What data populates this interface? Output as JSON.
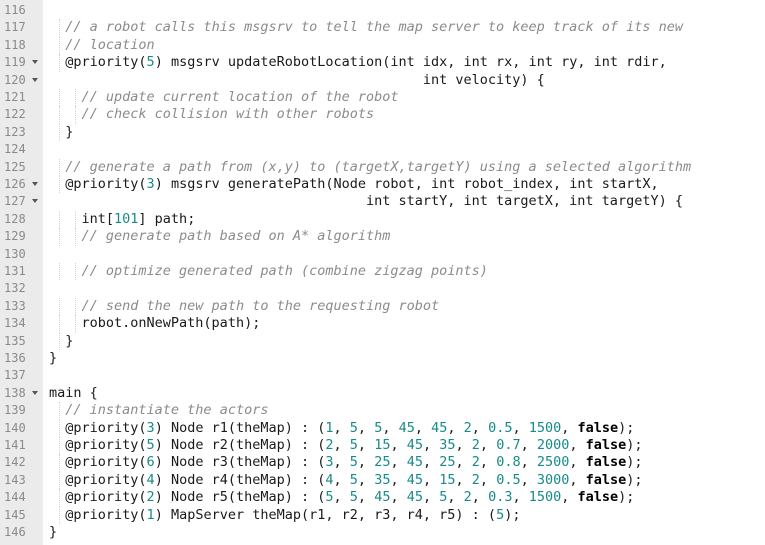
{
  "editor": {
    "lines": [
      {
        "num": "116",
        "fold": false,
        "indent": 0,
        "tokens": []
      },
      {
        "num": "117",
        "fold": false,
        "indent": 2,
        "tokens": [
          {
            "t": "comment",
            "v": "// a robot calls this msgsrv to tell the map server to keep track of its new"
          }
        ]
      },
      {
        "num": "118",
        "fold": false,
        "indent": 2,
        "tokens": [
          {
            "t": "comment",
            "v": "// location"
          }
        ]
      },
      {
        "num": "119",
        "fold": true,
        "indent": 2,
        "tokens": [
          {
            "t": "plain",
            "v": "@priority("
          },
          {
            "t": "number",
            "v": "5"
          },
          {
            "t": "plain",
            "v": ") msgsrv updateRobotLocation(int idx, int rx, int ry, int rdir,"
          }
        ]
      },
      {
        "num": "120",
        "fold": true,
        "indent": 0,
        "tokens": [
          {
            "t": "plain",
            "v": "                                              int velocity) {"
          }
        ]
      },
      {
        "num": "121",
        "fold": false,
        "indent": 4,
        "tokens": [
          {
            "t": "comment",
            "v": "// update current location of the robot"
          }
        ]
      },
      {
        "num": "122",
        "fold": false,
        "indent": 4,
        "tokens": [
          {
            "t": "comment",
            "v": "// check collision with other robots"
          }
        ]
      },
      {
        "num": "123",
        "fold": false,
        "indent": 2,
        "tokens": [
          {
            "t": "plain",
            "v": "}"
          }
        ]
      },
      {
        "num": "124",
        "fold": false,
        "indent": 0,
        "tokens": []
      },
      {
        "num": "125",
        "fold": false,
        "indent": 2,
        "tokens": [
          {
            "t": "comment",
            "v": "// generate a path from (x,y) to (targetX,targetY) using a selected algorithm"
          }
        ]
      },
      {
        "num": "126",
        "fold": true,
        "indent": 2,
        "tokens": [
          {
            "t": "plain",
            "v": "@priority("
          },
          {
            "t": "number",
            "v": "3"
          },
          {
            "t": "plain",
            "v": ") msgsrv generatePath(Node robot, int robot_index, int startX,"
          }
        ]
      },
      {
        "num": "127",
        "fold": true,
        "indent": 0,
        "tokens": [
          {
            "t": "plain",
            "v": "                                       int startY, int targetX, int targetY) {"
          }
        ]
      },
      {
        "num": "128",
        "fold": false,
        "indent": 4,
        "tokens": [
          {
            "t": "plain",
            "v": "int["
          },
          {
            "t": "number",
            "v": "101"
          },
          {
            "t": "plain",
            "v": "] path;"
          }
        ]
      },
      {
        "num": "129",
        "fold": false,
        "indent": 4,
        "tokens": [
          {
            "t": "comment",
            "v": "// generate path based on A* algorithm"
          }
        ]
      },
      {
        "num": "130",
        "fold": false,
        "indent": 0,
        "tokens": []
      },
      {
        "num": "131",
        "fold": false,
        "indent": 4,
        "tokens": [
          {
            "t": "comment",
            "v": "// optimize generated path (combine zigzag points)"
          }
        ]
      },
      {
        "num": "132",
        "fold": false,
        "indent": 0,
        "tokens": []
      },
      {
        "num": "133",
        "fold": false,
        "indent": 4,
        "tokens": [
          {
            "t": "comment",
            "v": "// send the new path to the requesting robot"
          }
        ]
      },
      {
        "num": "134",
        "fold": false,
        "indent": 4,
        "tokens": [
          {
            "t": "plain",
            "v": "robot.onNewPath(path);"
          }
        ]
      },
      {
        "num": "135",
        "fold": false,
        "indent": 2,
        "tokens": [
          {
            "t": "plain",
            "v": "}"
          }
        ]
      },
      {
        "num": "136",
        "fold": false,
        "indent": 0,
        "tokens": [
          {
            "t": "plain",
            "v": "}"
          }
        ]
      },
      {
        "num": "137",
        "fold": false,
        "indent": 0,
        "tokens": []
      },
      {
        "num": "138",
        "fold": true,
        "indent": 0,
        "tokens": [
          {
            "t": "plain",
            "v": "main {"
          }
        ]
      },
      {
        "num": "139",
        "fold": false,
        "indent": 2,
        "tokens": [
          {
            "t": "comment",
            "v": "// instantiate the actors"
          }
        ]
      },
      {
        "num": "140",
        "fold": false,
        "indent": 2,
        "tokens": [
          {
            "t": "plain",
            "v": "@priority("
          },
          {
            "t": "number",
            "v": "3"
          },
          {
            "t": "plain",
            "v": ") Node r1(theMap) : ("
          },
          {
            "t": "number",
            "v": "1"
          },
          {
            "t": "plain",
            "v": ", "
          },
          {
            "t": "number",
            "v": "5"
          },
          {
            "t": "plain",
            "v": ", "
          },
          {
            "t": "number",
            "v": "5"
          },
          {
            "t": "plain",
            "v": ", "
          },
          {
            "t": "number",
            "v": "45"
          },
          {
            "t": "plain",
            "v": ", "
          },
          {
            "t": "number",
            "v": "45"
          },
          {
            "t": "plain",
            "v": ", "
          },
          {
            "t": "number",
            "v": "2"
          },
          {
            "t": "plain",
            "v": ", "
          },
          {
            "t": "number",
            "v": "0.5"
          },
          {
            "t": "plain",
            "v": ", "
          },
          {
            "t": "number",
            "v": "1500"
          },
          {
            "t": "plain",
            "v": ", "
          },
          {
            "t": "keyword",
            "v": "false"
          },
          {
            "t": "plain",
            "v": ");"
          }
        ]
      },
      {
        "num": "141",
        "fold": false,
        "indent": 2,
        "tokens": [
          {
            "t": "plain",
            "v": "@priority("
          },
          {
            "t": "number",
            "v": "5"
          },
          {
            "t": "plain",
            "v": ") Node r2(theMap) : ("
          },
          {
            "t": "number",
            "v": "2"
          },
          {
            "t": "plain",
            "v": ", "
          },
          {
            "t": "number",
            "v": "5"
          },
          {
            "t": "plain",
            "v": ", "
          },
          {
            "t": "number",
            "v": "15"
          },
          {
            "t": "plain",
            "v": ", "
          },
          {
            "t": "number",
            "v": "45"
          },
          {
            "t": "plain",
            "v": ", "
          },
          {
            "t": "number",
            "v": "35"
          },
          {
            "t": "plain",
            "v": ", "
          },
          {
            "t": "number",
            "v": "2"
          },
          {
            "t": "plain",
            "v": ", "
          },
          {
            "t": "number",
            "v": "0.7"
          },
          {
            "t": "plain",
            "v": ", "
          },
          {
            "t": "number",
            "v": "2000"
          },
          {
            "t": "plain",
            "v": ", "
          },
          {
            "t": "keyword",
            "v": "false"
          },
          {
            "t": "plain",
            "v": ");"
          }
        ]
      },
      {
        "num": "142",
        "fold": false,
        "indent": 2,
        "tokens": [
          {
            "t": "plain",
            "v": "@priority("
          },
          {
            "t": "number",
            "v": "6"
          },
          {
            "t": "plain",
            "v": ") Node r3(theMap) : ("
          },
          {
            "t": "number",
            "v": "3"
          },
          {
            "t": "plain",
            "v": ", "
          },
          {
            "t": "number",
            "v": "5"
          },
          {
            "t": "plain",
            "v": ", "
          },
          {
            "t": "number",
            "v": "25"
          },
          {
            "t": "plain",
            "v": ", "
          },
          {
            "t": "number",
            "v": "45"
          },
          {
            "t": "plain",
            "v": ", "
          },
          {
            "t": "number",
            "v": "25"
          },
          {
            "t": "plain",
            "v": ", "
          },
          {
            "t": "number",
            "v": "2"
          },
          {
            "t": "plain",
            "v": ", "
          },
          {
            "t": "number",
            "v": "0.8"
          },
          {
            "t": "plain",
            "v": ", "
          },
          {
            "t": "number",
            "v": "2500"
          },
          {
            "t": "plain",
            "v": ", "
          },
          {
            "t": "keyword",
            "v": "false"
          },
          {
            "t": "plain",
            "v": ");"
          }
        ]
      },
      {
        "num": "143",
        "fold": false,
        "indent": 2,
        "tokens": [
          {
            "t": "plain",
            "v": "@priority("
          },
          {
            "t": "number",
            "v": "4"
          },
          {
            "t": "plain",
            "v": ") Node r4(theMap) : ("
          },
          {
            "t": "number",
            "v": "4"
          },
          {
            "t": "plain",
            "v": ", "
          },
          {
            "t": "number",
            "v": "5"
          },
          {
            "t": "plain",
            "v": ", "
          },
          {
            "t": "number",
            "v": "35"
          },
          {
            "t": "plain",
            "v": ", "
          },
          {
            "t": "number",
            "v": "45"
          },
          {
            "t": "plain",
            "v": ", "
          },
          {
            "t": "number",
            "v": "15"
          },
          {
            "t": "plain",
            "v": ", "
          },
          {
            "t": "number",
            "v": "2"
          },
          {
            "t": "plain",
            "v": ", "
          },
          {
            "t": "number",
            "v": "0.5"
          },
          {
            "t": "plain",
            "v": ", "
          },
          {
            "t": "number",
            "v": "3000"
          },
          {
            "t": "plain",
            "v": ", "
          },
          {
            "t": "keyword",
            "v": "false"
          },
          {
            "t": "plain",
            "v": ");"
          }
        ]
      },
      {
        "num": "144",
        "fold": false,
        "indent": 2,
        "tokens": [
          {
            "t": "plain",
            "v": "@priority("
          },
          {
            "t": "number",
            "v": "2"
          },
          {
            "t": "plain",
            "v": ") Node r5(theMap) : ("
          },
          {
            "t": "number",
            "v": "5"
          },
          {
            "t": "plain",
            "v": ", "
          },
          {
            "t": "number",
            "v": "5"
          },
          {
            "t": "plain",
            "v": ", "
          },
          {
            "t": "number",
            "v": "45"
          },
          {
            "t": "plain",
            "v": ", "
          },
          {
            "t": "number",
            "v": "45"
          },
          {
            "t": "plain",
            "v": ", "
          },
          {
            "t": "number",
            "v": "5"
          },
          {
            "t": "plain",
            "v": ", "
          },
          {
            "t": "number",
            "v": "2"
          },
          {
            "t": "plain",
            "v": ", "
          },
          {
            "t": "number",
            "v": "0.3"
          },
          {
            "t": "plain",
            "v": ", "
          },
          {
            "t": "number",
            "v": "1500"
          },
          {
            "t": "plain",
            "v": ", "
          },
          {
            "t": "keyword",
            "v": "false"
          },
          {
            "t": "plain",
            "v": ");"
          }
        ]
      },
      {
        "num": "145",
        "fold": false,
        "indent": 2,
        "tokens": [
          {
            "t": "plain",
            "v": "@priority("
          },
          {
            "t": "number",
            "v": "1"
          },
          {
            "t": "plain",
            "v": ") MapServer theMap(r1, r2, r3, r4, r5) : ("
          },
          {
            "t": "number",
            "v": "5"
          },
          {
            "t": "plain",
            "v": ");"
          }
        ]
      },
      {
        "num": "146",
        "fold": false,
        "indent": 0,
        "tokens": [
          {
            "t": "plain",
            "v": "}"
          }
        ]
      }
    ]
  },
  "colors": {
    "gutter_bg": "#ebebeb",
    "line_number": "#8a8a8a",
    "comment": "#8b8b8b",
    "number": "#178a8a",
    "keyword": "#000000",
    "text": "#1a1a1a"
  },
  "icons": {
    "fold_marker": "chevron-down-icon"
  }
}
